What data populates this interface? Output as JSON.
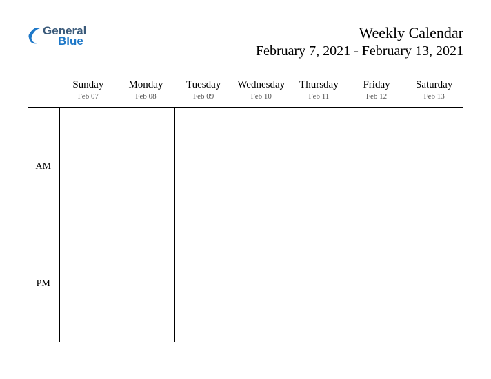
{
  "logo": {
    "line1": "General",
    "line2": "Blue",
    "color_primary": "#3a5a7a",
    "color_accent": "#1e78c8"
  },
  "header": {
    "title": "Weekly Calendar",
    "subtitle": "February 7, 2021 - February 13, 2021"
  },
  "days": [
    {
      "name": "Sunday",
      "date": "Feb 07"
    },
    {
      "name": "Monday",
      "date": "Feb 08"
    },
    {
      "name": "Tuesday",
      "date": "Feb 09"
    },
    {
      "name": "Wednesday",
      "date": "Feb 10"
    },
    {
      "name": "Thursday",
      "date": "Feb 11"
    },
    {
      "name": "Friday",
      "date": "Feb 12"
    },
    {
      "name": "Saturday",
      "date": "Feb 13"
    }
  ],
  "rows": [
    {
      "label": "AM"
    },
    {
      "label": "PM"
    }
  ]
}
